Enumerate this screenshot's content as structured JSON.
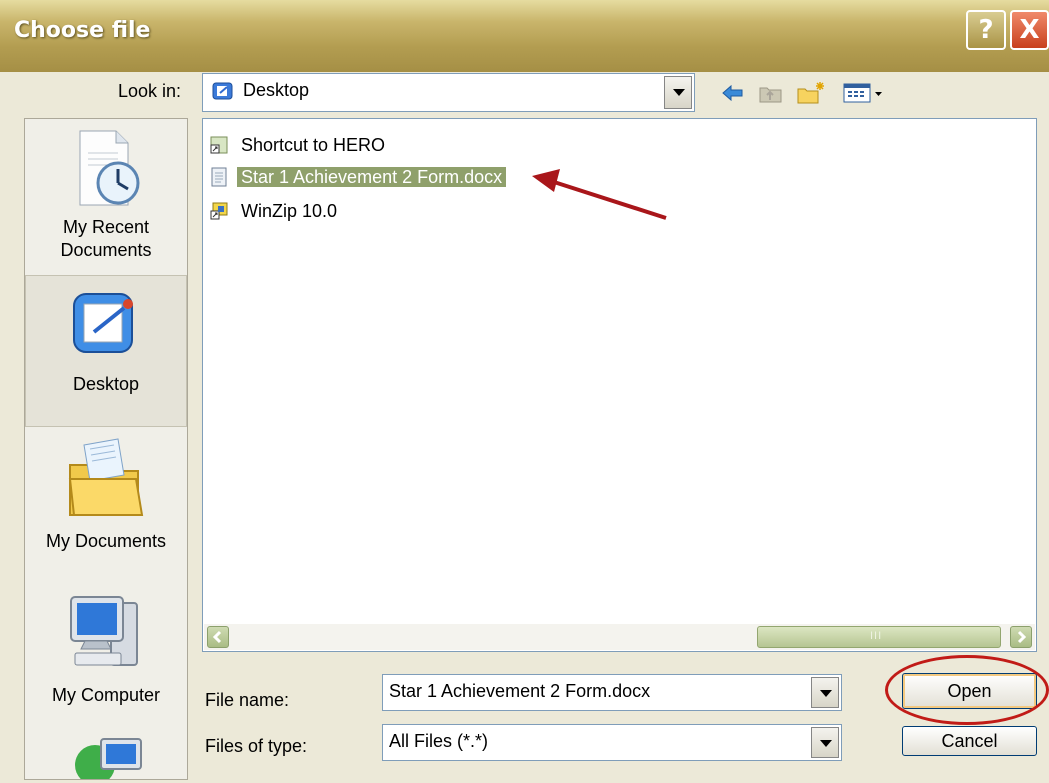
{
  "window": {
    "title": "Choose file"
  },
  "titlebar_buttons": {
    "help": "?",
    "close": "X"
  },
  "look_in": {
    "label": "Look in:",
    "value": "Desktop"
  },
  "places": [
    {
      "label": "My Recent Documents",
      "icon": "recent-documents-icon"
    },
    {
      "label": "Desktop",
      "icon": "desktop-icon",
      "selected": true
    },
    {
      "label": "My Documents",
      "icon": "my-documents-icon"
    },
    {
      "label": "My Computer",
      "icon": "my-computer-icon"
    },
    {
      "label": "",
      "icon": "network-places-icon"
    }
  ],
  "files": [
    {
      "name": "Shortcut to HERO",
      "icon": "shortcut-icon"
    },
    {
      "name": "Star 1 Achievement 2 Form.docx",
      "icon": "word-document-icon",
      "selected": true
    },
    {
      "name": "WinZip 10.0",
      "icon": "winzip-icon"
    }
  ],
  "file_name": {
    "label": "File name:",
    "value": "Star 1 Achievement 2 Form.docx"
  },
  "file_type": {
    "label": "Files of type:",
    "value": "All Files (*.*)"
  },
  "buttons": {
    "open": "Open",
    "cancel": "Cancel"
  },
  "colors": {
    "selection": "#8fa06b",
    "annotation": "#c11b17",
    "titlebar": "#b39d51"
  }
}
